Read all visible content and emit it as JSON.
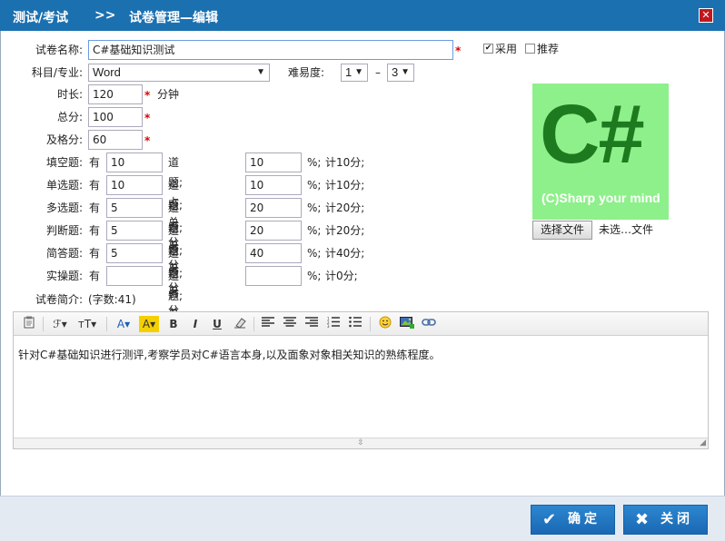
{
  "breadcrumb": {
    "section": "测试/考试",
    "separator": ">>",
    "page": "试卷管理—编辑"
  },
  "form": {
    "name_label": "试卷名称:",
    "name_value": "C#基础知识测试",
    "required_mark": "*",
    "enable_label": "采用",
    "enable_checked": "✔",
    "recommend_label": "推荐",
    "subject_label": "科目/专业:",
    "subject_value": "Word",
    "difficulty_label": "难易度:",
    "difficulty_min": "1",
    "difficulty_dash": "–",
    "difficulty_max": "3",
    "duration_label": "时长:",
    "duration_value": "120",
    "duration_unit": "分钟",
    "total_label": "总分:",
    "total_value": "100",
    "pass_label": "及格分:",
    "pass_value": "60",
    "row_has": "有",
    "row_mid": "道题;占总分",
    "row_pct": "%;",
    "rows": [
      {
        "label": "填空题:",
        "count": "10",
        "percent": "10",
        "score": "计10分;"
      },
      {
        "label": "单选题:",
        "count": "10",
        "percent": "10",
        "score": "计10分;"
      },
      {
        "label": "多选题:",
        "count": "5",
        "percent": "20",
        "score": "计20分;"
      },
      {
        "label": "判断题:",
        "count": "5",
        "percent": "20",
        "score": "计20分;"
      },
      {
        "label": "简答题:",
        "count": "5",
        "percent": "40",
        "score": "计40分;"
      },
      {
        "label": "实操题:",
        "count": "",
        "percent": "",
        "score": "计0分;"
      }
    ],
    "intro_label": "试卷简介:",
    "intro_count": "(字数:41)"
  },
  "logo": {
    "big": "C#",
    "tagline": "(C)Sharp your mind"
  },
  "file": {
    "button_label": "选择文件",
    "status": "未选…文件"
  },
  "editor": {
    "content": "针对C#基础知识进行测评,考察学员对C#语言本身,以及面象对象相关知识的熟练程度。",
    "toolbar": {
      "font_family": "ℱ▾",
      "font_size": "тT▾",
      "font_color": "A▾",
      "bg_color": "A▾",
      "bold": "B",
      "italic": "I",
      "underline": "U",
      "resize": "⇳",
      "grip": "◢"
    }
  },
  "footer": {
    "ok_label": "确定",
    "close_label": "关闭",
    "ok_icon": "✔",
    "close_icon": "✖"
  },
  "titlebar": {
    "close_icon": "✕"
  },
  "colors": {
    "title_bar": "#1b70b0",
    "button": "#1a68b3",
    "required": "#dd0000",
    "logo_bg": "#8ef08a",
    "logo_text": "#1e7a1e"
  }
}
